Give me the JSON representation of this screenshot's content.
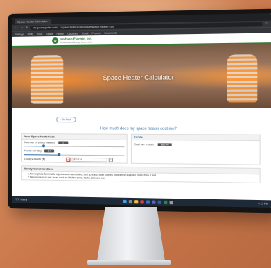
{
  "browser": {
    "tab_title": "Space Heater Calculator",
    "url": "rtc.powerpolar.com/…/space-heater-calculator/space-heater-calc",
    "bookmarks": [
      "Settings",
      "Utility",
      "Tools",
      "Space",
      "Heater",
      "Calculator",
      "Email",
      "Projects",
      "Documents"
    ]
  },
  "site": {
    "logo_mark": "W",
    "logo_name": "Wabash Electric, Inc.",
    "logo_tagline": "A Touchstone Energy Cooperative"
  },
  "hero": {
    "title": "Space Heater Calculator"
  },
  "page": {
    "back_label": "‹ Go Back",
    "question": "How much does my space heater cost me?"
  },
  "inputs_panel": {
    "title": "Your Space Heater Use",
    "heaters": {
      "label": "Number of space heaters",
      "value": "2",
      "fraction": 0.2
    },
    "hours": {
      "label": "Hours per day",
      "value": "8.4",
      "fraction": 0.35
    },
    "cost": {
      "label": "Cost per kWh ($)",
      "value": "$ 0.124",
      "minus": "−",
      "plus": "+"
    }
  },
  "total_panel": {
    "title": "TOTAL",
    "label": "Cost per month",
    "value": "$86.46"
  },
  "safety": {
    "title": "Safety Considerations",
    "items": [
      "1. Never place flammable objects such as curtains, bed spreads, table clothes or cleaning supplies closer than 3 feet.",
      "2. Never use near wet areas such as kitchen sinks, baths, showers etc."
    ]
  },
  "taskbar": {
    "weather": "75°F Sunny",
    "time": "4:15 PM"
  },
  "colors": {
    "accent_green": "#2e7d32",
    "link_blue": "#2e6da4",
    "badge_gray": "#555555"
  }
}
